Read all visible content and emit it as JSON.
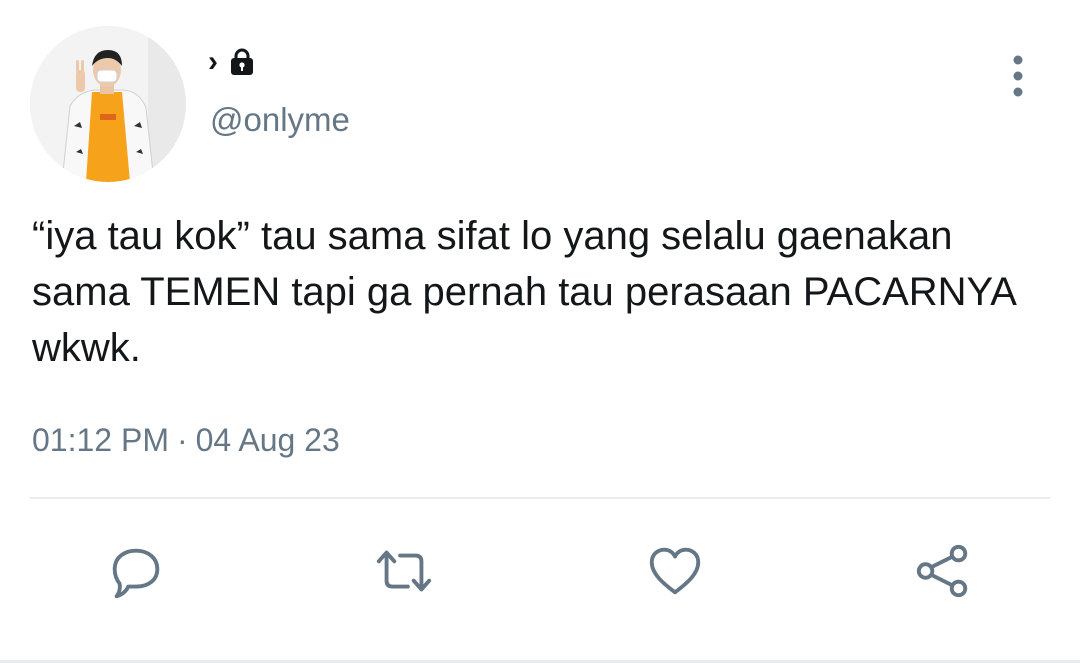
{
  "tweet": {
    "display_name": "›",
    "handle": "@onlyme",
    "text": "“iya tau kok” tau sama sifat lo yang selalu gaenakan sama TEMEN tapi ga pernah tau perasaan PACARNYA wkwk.",
    "time": "01:12 PM",
    "separator": "·",
    "date": "04 Aug 23",
    "protected": true
  },
  "icons": {
    "lock": "lock-icon",
    "more": "more-vertical-icon",
    "reply": "reply-icon",
    "retweet": "retweet-icon",
    "like": "heart-icon",
    "share": "share-icon"
  },
  "colors": {
    "text_primary": "#14171a",
    "text_secondary": "#657786",
    "icon": "#657786",
    "divider": "#e6ecf0",
    "avatar_shirt": "#f7a21b"
  }
}
